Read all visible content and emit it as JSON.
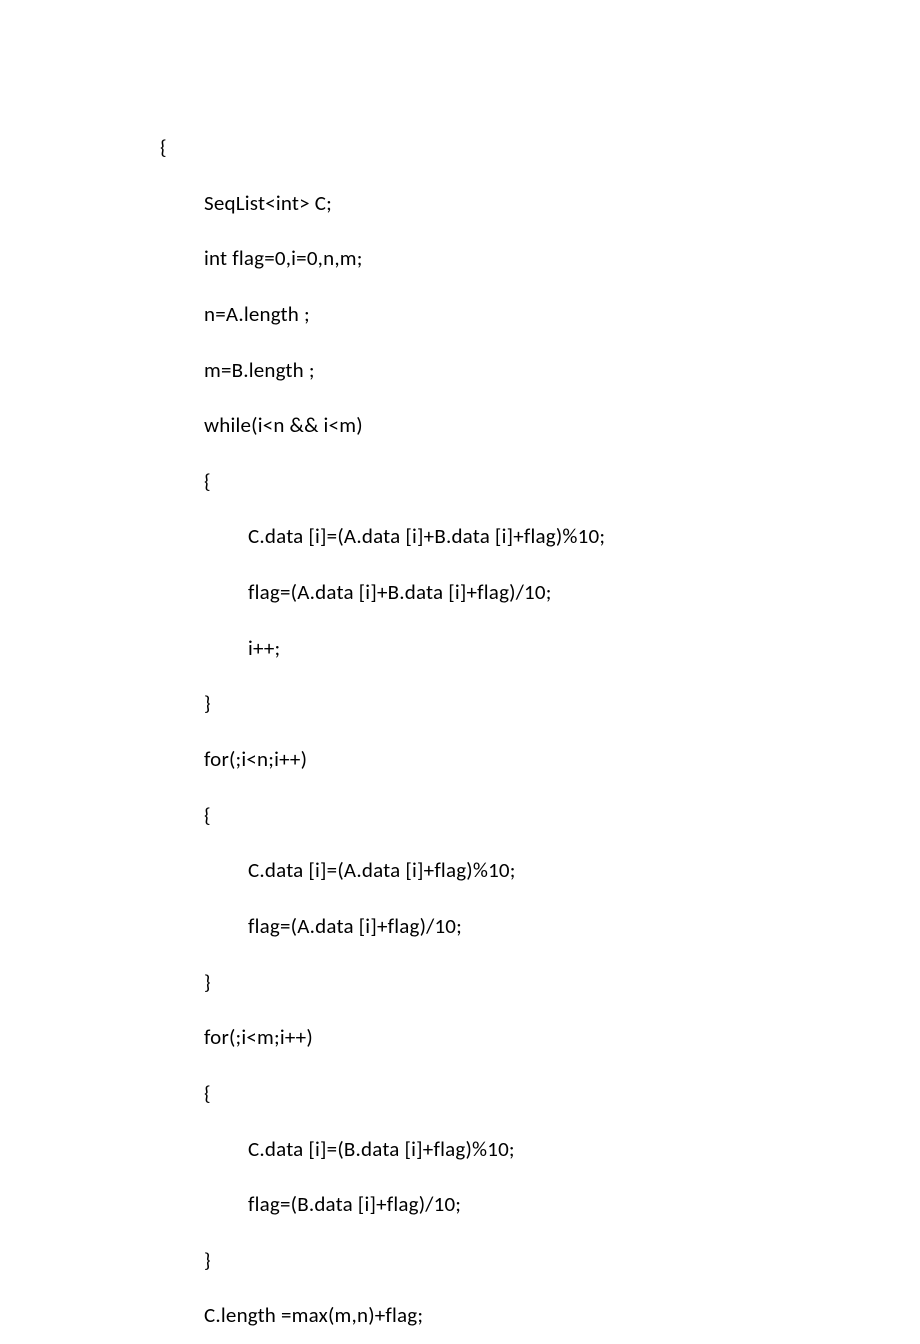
{
  "lines": [
    {
      "indent": 0,
      "text": "{"
    },
    {
      "indent": 1,
      "text": "SeqList<int> C;"
    },
    {
      "indent": 1,
      "text": "int flag=0,i=0,n,m;"
    },
    {
      "indent": 1,
      "text": "n=A.length ;"
    },
    {
      "indent": 1,
      "text": "m=B.length ;"
    },
    {
      "indent": 1,
      "text": "while(i<n && i<m)"
    },
    {
      "indent": 1,
      "text": "{"
    },
    {
      "indent": 2,
      "text": "C.data [i]=(A.data [i]+B.data [i]+flag)%10;"
    },
    {
      "indent": 2,
      "text": "flag=(A.data [i]+B.data [i]+flag)/10;"
    },
    {
      "indent": 2,
      "text": "i++;"
    },
    {
      "indent": 1,
      "text": "}"
    },
    {
      "indent": 1,
      "text": "for(;i<n;i++)"
    },
    {
      "indent": 1,
      "text": "{"
    },
    {
      "indent": 2,
      "text": "C.data [i]=(A.data [i]+flag)%10;"
    },
    {
      "indent": 2,
      "text": "flag=(A.data [i]+flag)/10;"
    },
    {
      "indent": 1,
      "text": "}"
    },
    {
      "indent": 1,
      "text": "for(;i<m;i++)"
    },
    {
      "indent": 1,
      "text": "{"
    },
    {
      "indent": 2,
      "text": "C.data [i]=(B.data [i]+flag)%10;"
    },
    {
      "indent": 2,
      "text": "flag=(B.data [i]+flag)/10;"
    },
    {
      "indent": 1,
      "text": "}"
    },
    {
      "indent": 1,
      "text": "C.length =max(m,n)+flag;"
    }
  ]
}
